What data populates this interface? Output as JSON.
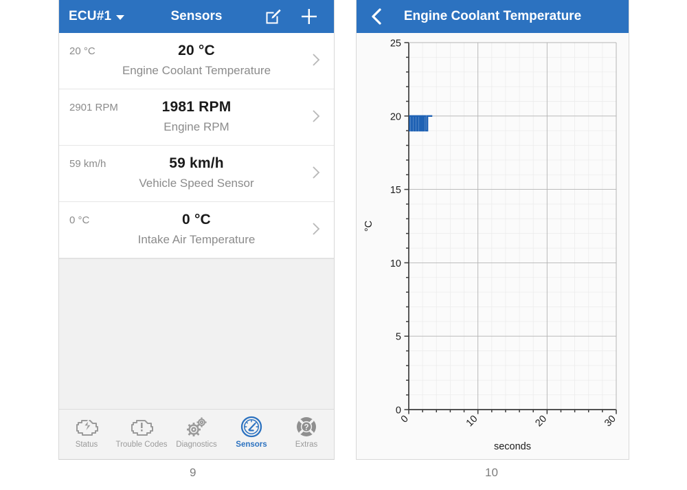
{
  "left_panel": {
    "navbar": {
      "ecu_label": "ECU#1",
      "dropdown_icon": "chevron-down-icon",
      "title": "Sensors",
      "edit_icon": "edit-square-pencil-icon",
      "add_icon": "plus-icon"
    },
    "sensors": [
      {
        "min": "20 °C",
        "value": "20 °C",
        "name": "Engine Coolant Temperature"
      },
      {
        "min": "2901 RPM",
        "value": "1981 RPM",
        "name": "Engine RPM"
      },
      {
        "min": "59 km/h",
        "value": "59 km/h",
        "name": "Vehicle Speed Sensor"
      },
      {
        "min": "0 °C",
        "value": "0 °C",
        "name": "Intake Air Temperature"
      }
    ],
    "tabbar": [
      {
        "label": "Status",
        "icon": "engine-lightning-icon",
        "active": false
      },
      {
        "label": "Trouble Codes",
        "icon": "engine-warning-icon",
        "active": false
      },
      {
        "label": "Diagnostics",
        "icon": "gears-icon",
        "active": false
      },
      {
        "label": "Sensors",
        "icon": "gauge-icon",
        "active": true
      },
      {
        "label": "Extras",
        "icon": "life-ring-question-icon",
        "active": false
      }
    ]
  },
  "right_panel": {
    "navbar": {
      "back_icon": "back-chevron-icon",
      "title": "Engine Coolant Temperature"
    }
  },
  "chart_data": {
    "type": "line",
    "title": "Engine Coolant Temperature",
    "xlabel": "seconds",
    "ylabel": "°C",
    "xlim": [
      0,
      30
    ],
    "ylim": [
      0,
      25
    ],
    "xticks": [
      0,
      10,
      20,
      30
    ],
    "yticks": [
      0,
      5,
      10,
      15,
      20,
      25
    ],
    "xtick_labels": [
      "0",
      "10",
      "20",
      "30"
    ],
    "ytick_labels": [
      "0",
      "5",
      "10",
      "15",
      "20",
      "25"
    ],
    "grid": true,
    "minor_grid": true,
    "legend": "none",
    "line_color": "#1f62b4",
    "series": [
      {
        "name": "Engine Coolant Temperature",
        "x": [
          0.0,
          0.15,
          0.15,
          0.4,
          0.4,
          0.55,
          0.55,
          0.8,
          0.8,
          0.95,
          0.95,
          1.2,
          1.2,
          1.35,
          1.35,
          1.6,
          1.6,
          1.8,
          1.8,
          2.0,
          2.0,
          2.2,
          2.2,
          2.45,
          2.45,
          2.7,
          2.7,
          3.4
        ],
        "y": [
          19.0,
          19.0,
          20.0,
          20.0,
          19.0,
          19.0,
          20.0,
          20.0,
          19.0,
          19.0,
          20.0,
          20.0,
          19.0,
          19.0,
          20.0,
          20.0,
          19.0,
          19.0,
          20.0,
          20.0,
          19.0,
          19.0,
          20.0,
          20.0,
          19.0,
          19.0,
          20.0,
          20.0
        ]
      }
    ]
  },
  "figure": {
    "page_number_left": "9",
    "page_number_right": "10"
  }
}
